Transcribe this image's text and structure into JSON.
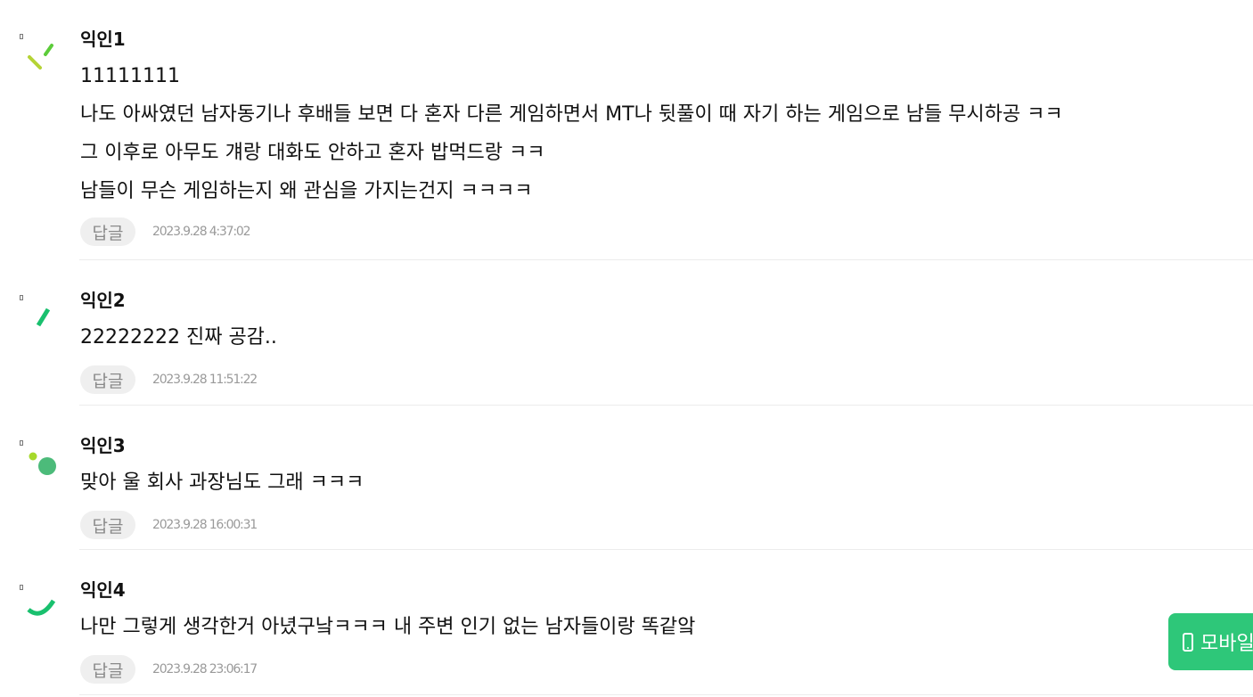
{
  "comments": [
    {
      "author": "익인1",
      "lines": [
        "11111111",
        "나도 아싸였던 남자동기나 후배들 보면 다 혼자 다른 게임하면서 MT나 뒷풀이 때 자기 하는 게임으로 남들 무시하공 ㅋㅋ",
        "그 이후로 아무도 걔랑 대화도 안하고 혼자 밥먹드랑 ㅋㅋ",
        "남들이 무슨 게임하는지 왜 관심을 가지는건지 ㅋㅋㅋㅋ"
      ],
      "reply_label": "답글",
      "timestamp": "2023.9.28 4:37:02",
      "avatar_icon": "two-dash-avatar-icon"
    },
    {
      "author": "익인2",
      "lines": [
        "22222222 진짜 공감.."
      ],
      "reply_label": "답글",
      "timestamp": "2023.9.28 11:51:22",
      "avatar_icon": "slash-avatar-icon"
    },
    {
      "author": "익인3",
      "lines": [
        "맞아 울 회사 과장님도 그래 ㅋㅋㅋ"
      ],
      "reply_label": "답글",
      "timestamp": "2023.9.28 16:00:31",
      "avatar_icon": "dots-avatar-icon"
    },
    {
      "author": "익인4",
      "lines": [
        "나만 그렇게 생각한거 아녔구낰ㅋㅋㅋ 내 주변 인기 없는 남자들이랑 똑같앜"
      ],
      "reply_label": "답글",
      "timestamp": "2023.9.28 23:06:17",
      "avatar_icon": "arc-avatar-icon"
    }
  ],
  "mobile_button": {
    "label": "모바일",
    "icon": "phone-icon"
  },
  "colors": {
    "accent_green": "#2ec779",
    "lime": "#b5d335",
    "reply_bg": "#efefef",
    "divider": "#ececec"
  }
}
